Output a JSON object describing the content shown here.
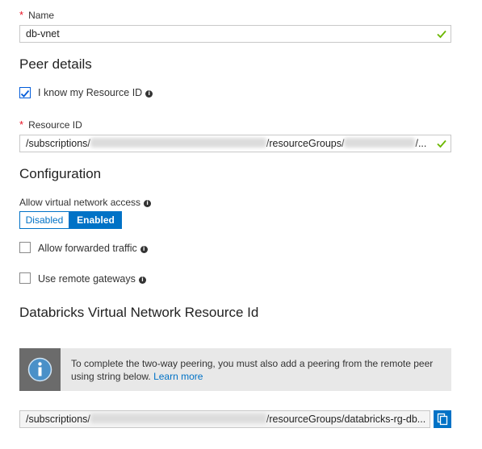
{
  "name_field": {
    "required_mark": "*",
    "label": "Name",
    "value": "db-vnet"
  },
  "peer_details": {
    "title": "Peer details",
    "know_resource_id": {
      "label": "I know my Resource ID",
      "checked": true
    },
    "resource_id": {
      "required_mark": "*",
      "label": "Resource ID",
      "prefix": "/subscriptions/",
      "middle": "/resourceGroups/",
      "suffix": "/..."
    }
  },
  "configuration": {
    "title": "Configuration",
    "allow_vnet_access": {
      "label": "Allow virtual network access",
      "options": [
        "Disabled",
        "Enabled"
      ],
      "selected": "Enabled"
    },
    "allow_forwarded_traffic": {
      "label": "Allow forwarded traffic",
      "checked": false
    },
    "use_remote_gateways": {
      "label": "Use remote gateways",
      "checked": false
    }
  },
  "databricks": {
    "title": "Databricks Virtual Network Resource Id",
    "info_text_line1": "To complete the two-way peering, you must also add a peering from the remote peer",
    "info_text_line2": "using string below.",
    "learn_more": "Learn more",
    "resource_string": {
      "prefix": "/subscriptions/",
      "middle": "/resourceGroups/databricks-rg-db..."
    }
  },
  "colors": {
    "accent": "#0072c6",
    "required": "#e81123",
    "valid": "#6bb700"
  }
}
